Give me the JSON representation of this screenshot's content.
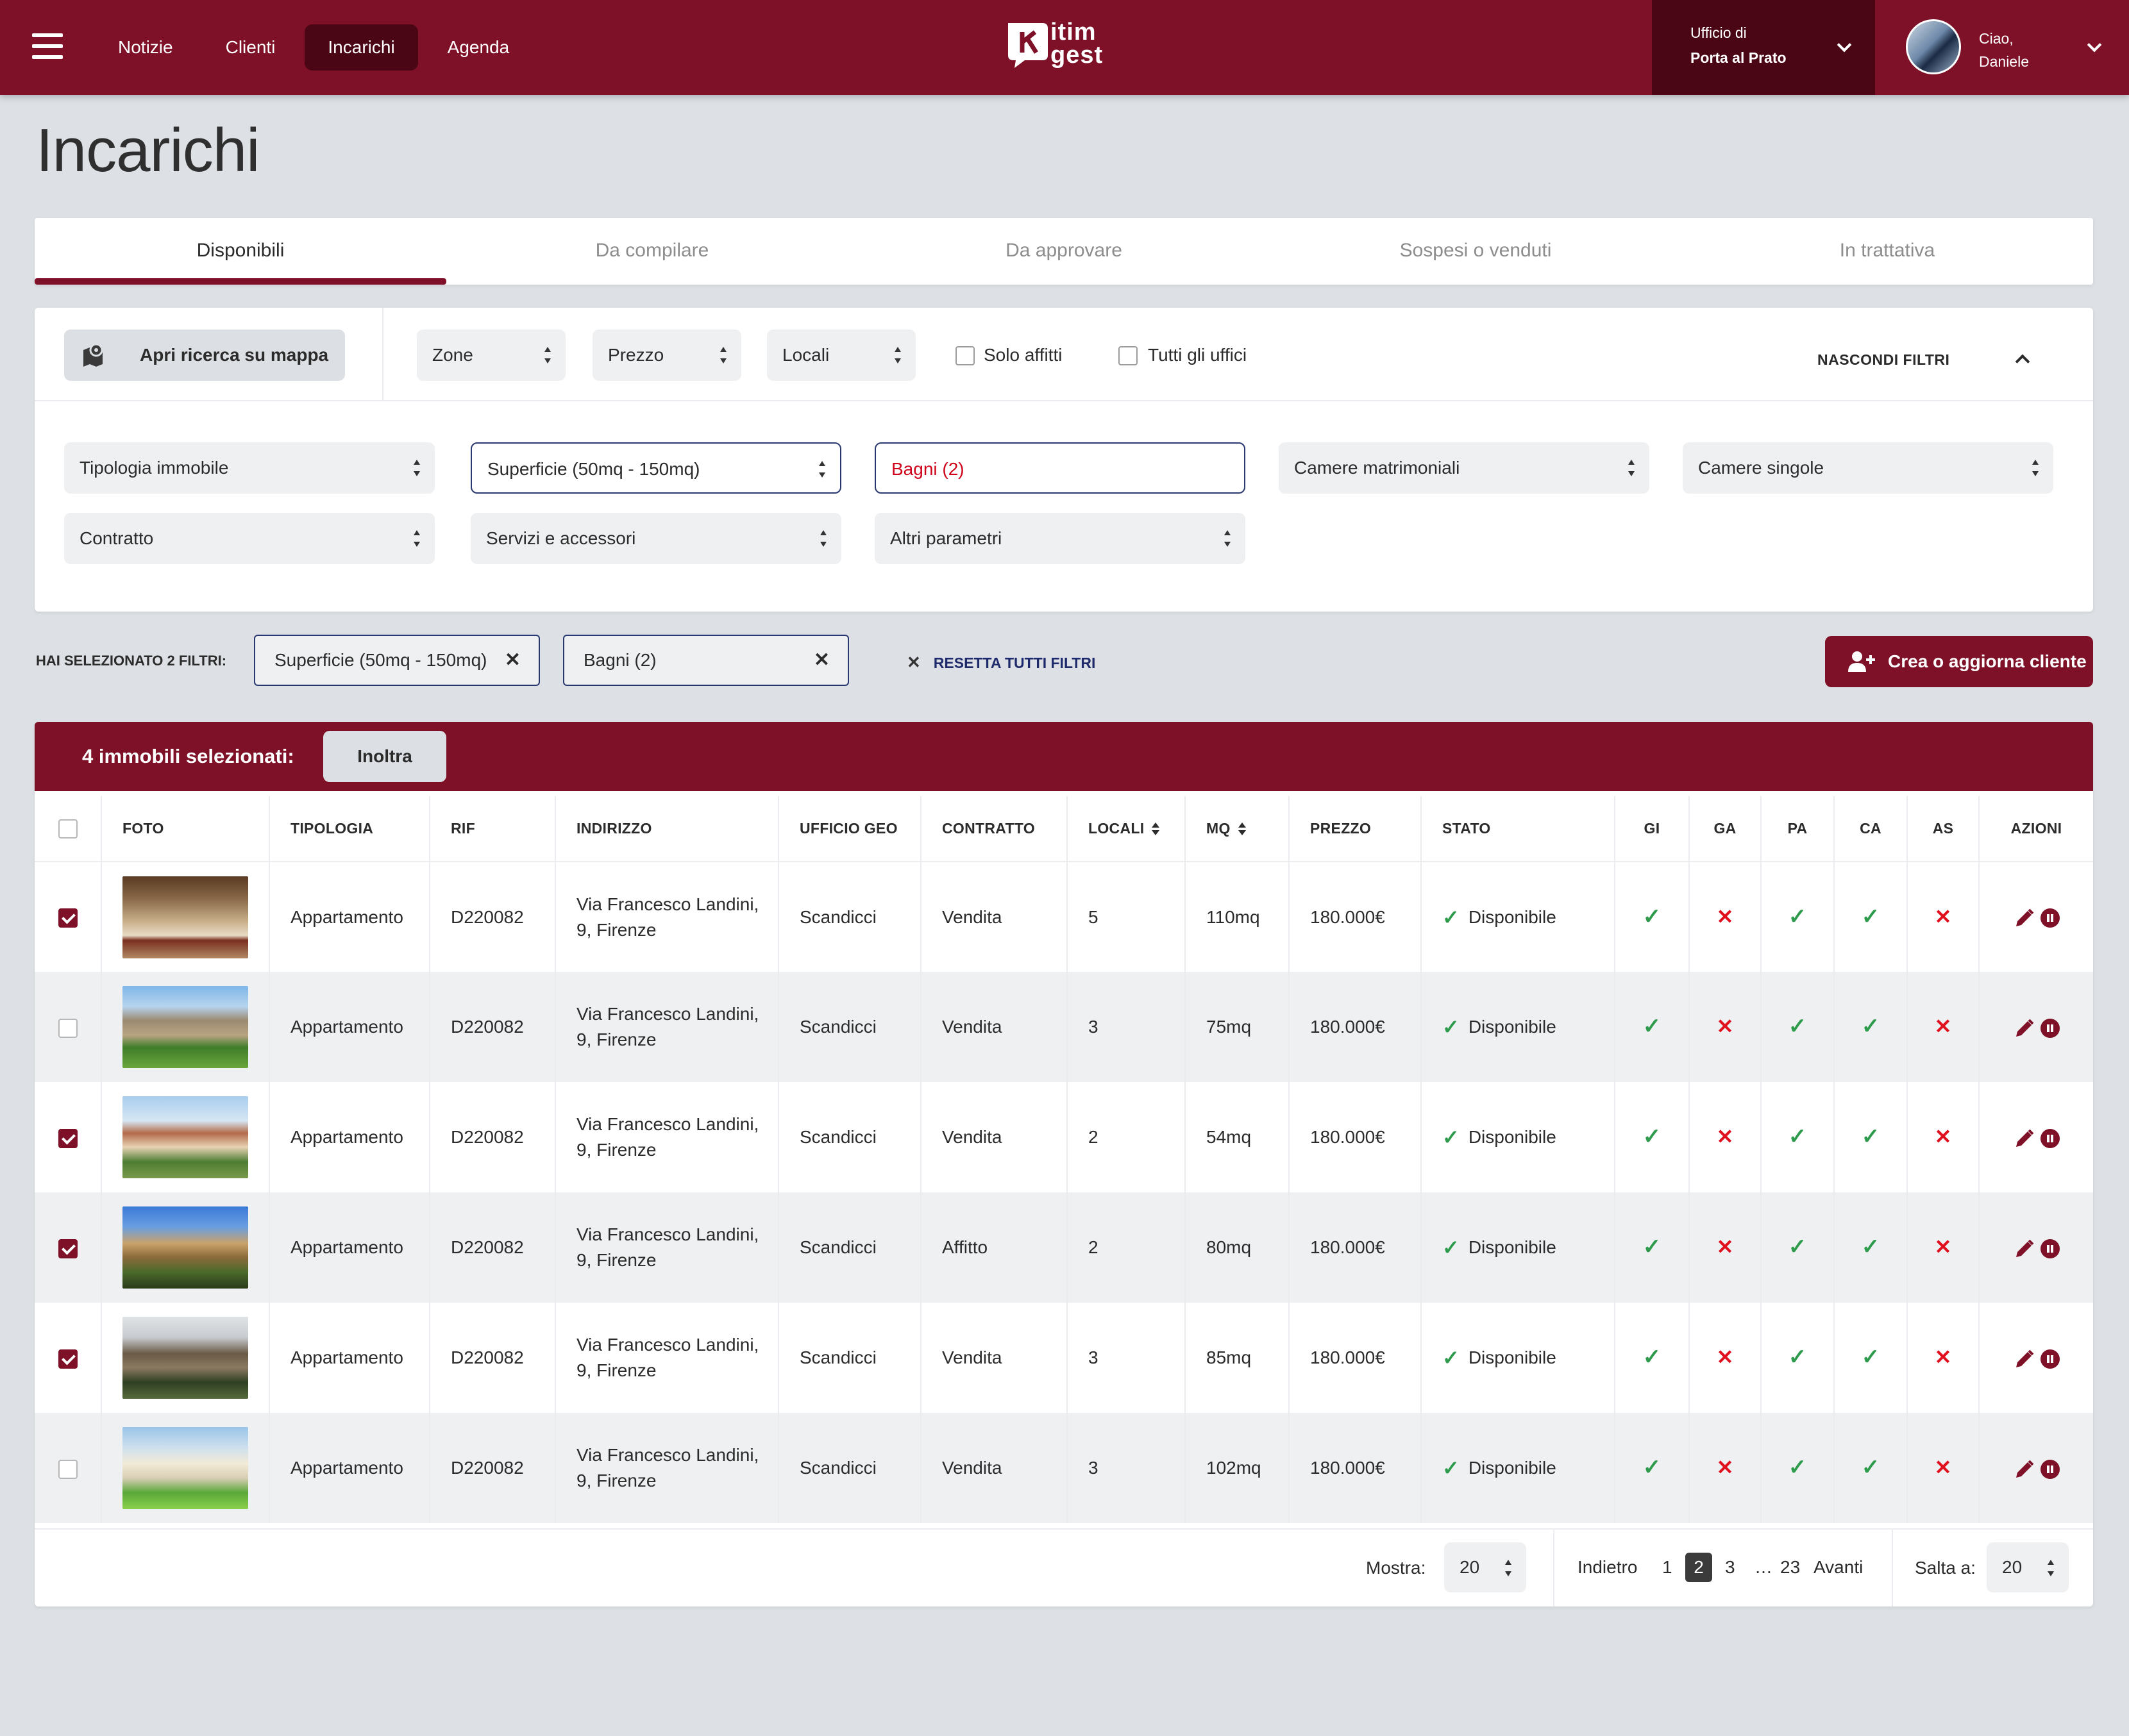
{
  "nav": {
    "items": [
      "Notizie",
      "Clienti",
      "Incarichi",
      "Agenda"
    ],
    "active": "Incarichi"
  },
  "logo": {
    "line1": "itim",
    "line2": "gest"
  },
  "office": {
    "label": "Ufficio di",
    "name": "Porta al Prato"
  },
  "user": {
    "greeting": "Ciao,",
    "name": "Daniele"
  },
  "page_title": "Incarichi",
  "tabs": [
    "Disponibili",
    "Da compilare",
    "Da approvare",
    "Sospesi o venduti",
    "In trattativa"
  ],
  "filters": {
    "map_button": "Apri ricerca su mappa",
    "top": [
      "Zone",
      "Prezzo",
      "Locali"
    ],
    "checks": [
      "Solo affitti",
      "Tutti gli uffici"
    ],
    "hide_label": "NASCONDI FILTRI",
    "row1": [
      "Tipologia immobile",
      "Superficie (50mq - 150mq)",
      "Bagni (2)",
      "Camere matrimoniali",
      "Camere singole"
    ],
    "row2": [
      "Contratto",
      "Servizi e accessori",
      "Altri parametri"
    ]
  },
  "summary": {
    "label_pre": "HAI SELEZIONATO ",
    "count": "2",
    "label_post": " FILTRI:",
    "chips": [
      "Superficie (50mq - 150mq)",
      "Bagni (2)"
    ],
    "reset": "RESETTA TUTTI FILTRI",
    "create_button": "Crea o aggiorna cliente"
  },
  "selection": {
    "text": "4 immobili selezionati:",
    "forward_button": "Inoltra"
  },
  "table": {
    "headers": [
      "FOTO",
      "TIPOLOGIA",
      "RIF",
      "INDIRIZZO",
      "UFFICIO GEO",
      "CONTRATTO",
      "LOCALI",
      "MQ",
      "PREZZO",
      "STATO",
      "GI",
      "GA",
      "PA",
      "CA",
      "AS",
      "AZIONI"
    ],
    "rows": [
      {
        "checked": true,
        "photo": "interior",
        "tipologia": "Appartamento",
        "rif": "D220082",
        "addr1": "Via Francesco Landini,",
        "addr2": "9, Firenze",
        "ufficio": "Scandicci",
        "contratto": "Vendita",
        "locali": "5",
        "mq": "110mq",
        "prezzo": "180.000€",
        "stato": "Disponibile",
        "flags": [
          true,
          false,
          true,
          true,
          false
        ]
      },
      {
        "checked": false,
        "photo": "stone-house",
        "tipologia": "Appartamento",
        "rif": "D220082",
        "addr1": "Via Francesco Landini,",
        "addr2": "9, Firenze",
        "ufficio": "Scandicci",
        "contratto": "Vendita",
        "locali": "3",
        "mq": "75mq",
        "prezzo": "180.000€",
        "stato": "Disponibile",
        "flags": [
          true,
          false,
          true,
          true,
          false
        ]
      },
      {
        "checked": true,
        "photo": "villa",
        "tipologia": "Appartamento",
        "rif": "D220082",
        "addr1": "Via Francesco Landini,",
        "addr2": "9, Firenze",
        "ufficio": "Scandicci",
        "contratto": "Vendita",
        "locali": "2",
        "mq": "54mq",
        "prezzo": "180.000€",
        "stato": "Disponibile",
        "flags": [
          true,
          false,
          true,
          true,
          false
        ]
      },
      {
        "checked": true,
        "photo": "terrace-villa",
        "tipologia": "Appartamento",
        "rif": "D220082",
        "addr1": "Via Francesco Landini,",
        "addr2": "9, Firenze",
        "ufficio": "Scandicci",
        "contratto": "Affitto",
        "locali": "2",
        "mq": "80mq",
        "prezzo": "180.000€",
        "stato": "Disponibile",
        "flags": [
          true,
          false,
          true,
          true,
          false
        ]
      },
      {
        "checked": true,
        "photo": "rustic",
        "tipologia": "Appartamento",
        "rif": "D220082",
        "addr1": "Via Francesco Landini,",
        "addr2": "9, Firenze",
        "ufficio": "Scandicci",
        "contratto": "Vendita",
        "locali": "3",
        "mq": "85mq",
        "prezzo": "180.000€",
        "stato": "Disponibile",
        "flags": [
          true,
          false,
          true,
          true,
          false
        ]
      },
      {
        "checked": false,
        "photo": "garden-house",
        "tipologia": "Appartamento",
        "rif": "D220082",
        "addr1": "Via Francesco Landini,",
        "addr2": "9, Firenze",
        "ufficio": "Scandicci",
        "contratto": "Vendita",
        "locali": "3",
        "mq": "102mq",
        "prezzo": "180.000€",
        "stato": "Disponibile",
        "flags": [
          true,
          false,
          true,
          true,
          false
        ]
      }
    ]
  },
  "pagination": {
    "show_label": "Mostra:",
    "show_value": "20",
    "back": "Indietro",
    "pages": [
      "1",
      "2",
      "3",
      "…",
      "23"
    ],
    "current": "2",
    "next": "Avanti",
    "jump_label": "Salta a:",
    "jump_value": "20"
  },
  "icons": {
    "menu": "hamburger-icon",
    "map": "map-pin-icon",
    "add_user": "user-plus-icon",
    "ok": "check-icon",
    "no": "cross-icon",
    "edit": "pencil-icon",
    "pause": "pause-icon"
  },
  "colors": {
    "brand": "#7e1127",
    "brand_dark": "#4a0614",
    "ok": "#2e9b4c",
    "no": "#e0101e",
    "focus_border": "#2a3870"
  }
}
